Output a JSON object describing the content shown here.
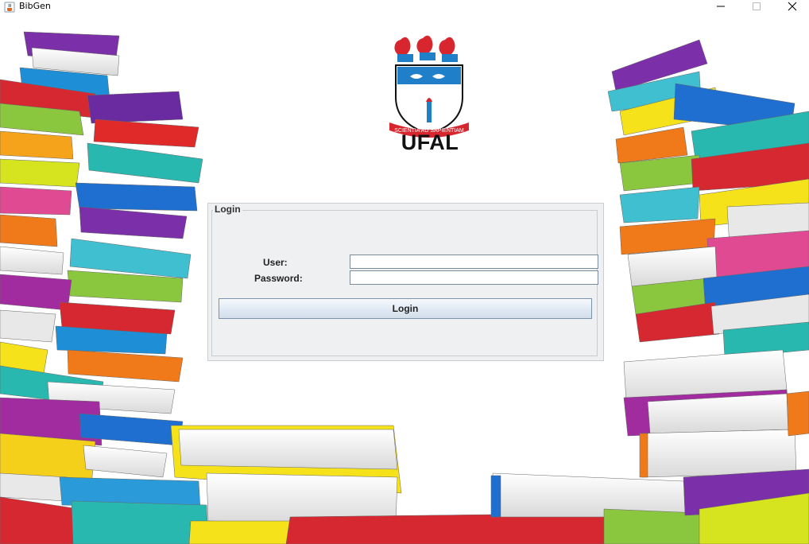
{
  "window": {
    "title": "BibGen",
    "app_icon": "java-cup-icon",
    "controls": [
      "minimize-icon",
      "maximize-icon",
      "close-icon"
    ]
  },
  "logo": {
    "name": "ufal-coat-of-arms",
    "motto": "SCIENTIA AD SAPIENTIAM",
    "text": "UFAL"
  },
  "login": {
    "legend": "Login",
    "user_label": "User:",
    "password_label": "Password:",
    "user_value": "",
    "password_value": "",
    "button_label": "Login"
  },
  "colors": {
    "panel_bg": "#eef0f2",
    "logo_red": "#d8262e",
    "logo_blue": "#1f7fc9"
  }
}
